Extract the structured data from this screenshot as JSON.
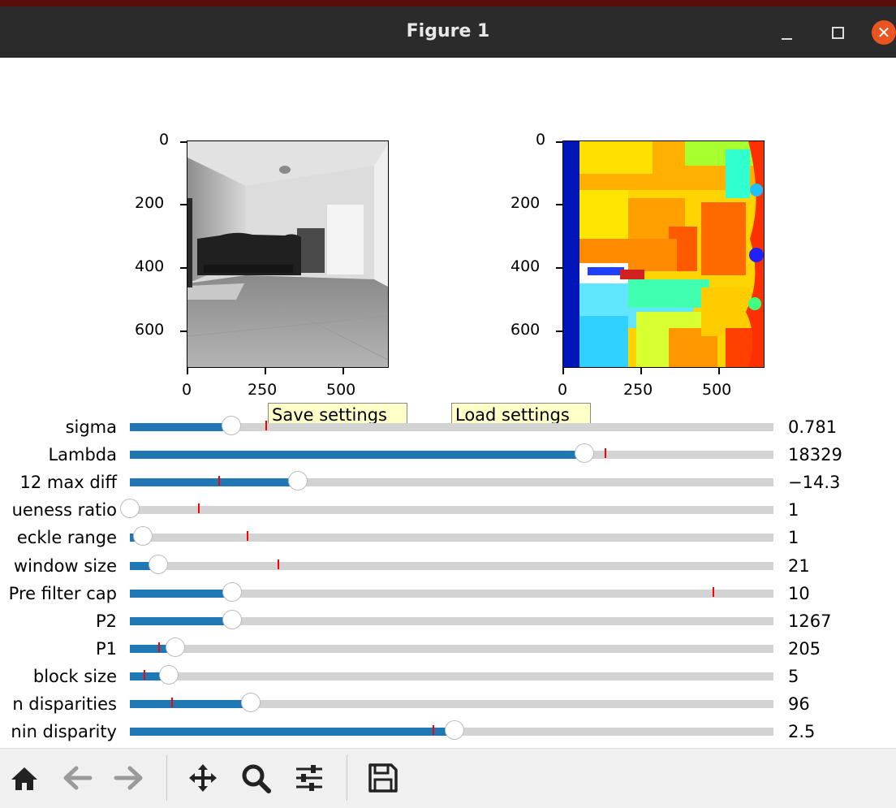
{
  "window": {
    "title": "Figure 1"
  },
  "images": {
    "left": {
      "kind": "grayscale camera frame of a room with a couch",
      "icon": "camera-image"
    },
    "right": {
      "kind": "colored disparity map (jet colormap)",
      "icon": "disparity-map"
    }
  },
  "axes": {
    "y_ticks": [
      "0",
      "200",
      "400",
      "600"
    ],
    "x_ticks": [
      "0",
      "250",
      "500"
    ]
  },
  "buttons": {
    "save": "Save settings",
    "load": "Load settings"
  },
  "sliders": [
    {
      "label": "sigma",
      "value": "0.781",
      "fill": 0.158,
      "init": 0.211
    },
    {
      "label": "Lambda",
      "value": "18329",
      "fill": 0.706,
      "init": 0.738
    },
    {
      "label": "12 max diff",
      "value": "−14.3",
      "fill": 0.261,
      "init": 0.138
    },
    {
      "label": "ueness ratio",
      "value": "1",
      "fill": 0.0,
      "init": 0.106
    },
    {
      "label": "eckle range",
      "value": "1",
      "fill": 0.02,
      "init": 0.182
    },
    {
      "label": "window size",
      "value": "21",
      "fill": 0.044,
      "init": 0.229
    },
    {
      "label": "Pre filter cap",
      "value": "10",
      "fill": 0.159,
      "init": 0.905
    },
    {
      "label": "P2",
      "value": "1267",
      "fill": 0.159,
      "init": null
    },
    {
      "label": "P1",
      "value": "205",
      "fill": 0.07,
      "init": 0.044
    },
    {
      "label": "block size",
      "value": "5",
      "fill": 0.06,
      "init": 0.022
    },
    {
      "label": "n disparities",
      "value": "96",
      "fill": 0.188,
      "init": 0.064
    },
    {
      "label": "nin disparity",
      "value": "2.5",
      "fill": 0.504,
      "init": 0.47
    }
  ],
  "toolbar": {
    "home": "home-icon",
    "back": "back-arrow-icon",
    "forward": "forward-arrow-icon",
    "pan": "pan-icon",
    "zoom": "zoom-icon",
    "configure": "configure-subplots-icon",
    "save": "save-icon"
  }
}
